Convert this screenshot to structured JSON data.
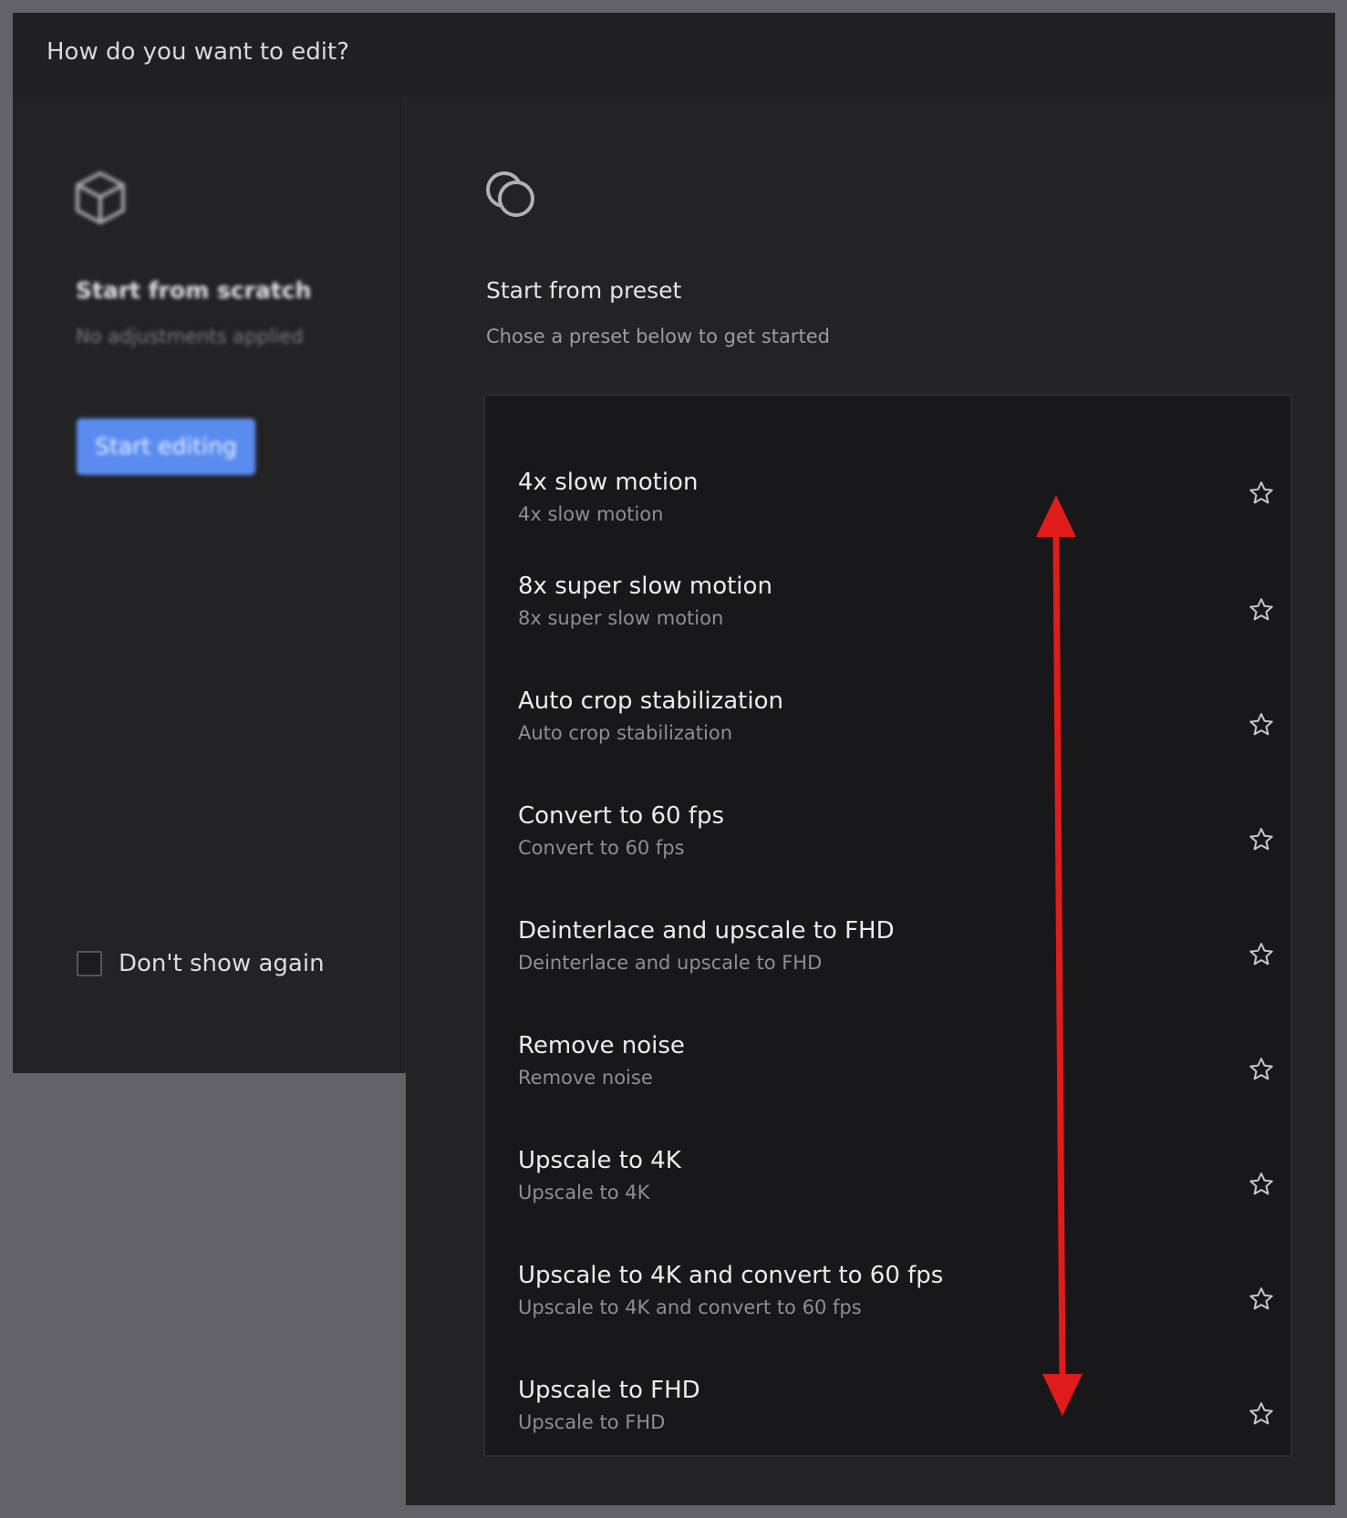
{
  "dialog": {
    "title": "How do you want to edit?"
  },
  "scratch": {
    "icon": "cube-icon",
    "title": "Start from scratch",
    "subtitle": "No adjustments applied",
    "button_label": "Start editing",
    "button_color": "#5a8cf0",
    "checkbox_label": "Don't show again",
    "checkbox_checked": false
  },
  "preset": {
    "icon": "overlapping-circles-icon",
    "title": "Start from preset",
    "subtitle": "Chose a preset below to get started",
    "items": [
      {
        "name": "4x slow motion",
        "description": "4x slow motion",
        "icon": "star-outline-icon"
      },
      {
        "name": "8x super slow motion",
        "description": "8x super slow motion",
        "icon": "star-outline-icon"
      },
      {
        "name": "Auto crop stabilization",
        "description": "Auto crop stabilization",
        "icon": "star-outline-icon"
      },
      {
        "name": "Convert to 60 fps",
        "description": "Convert to 60 fps",
        "icon": "star-outline-icon"
      },
      {
        "name": "Deinterlace and upscale to FHD",
        "description": "Deinterlace and upscale to FHD",
        "icon": "star-outline-icon"
      },
      {
        "name": "Remove noise",
        "description": "Remove noise",
        "icon": "star-outline-icon"
      },
      {
        "name": "Upscale to 4K",
        "description": "Upscale to 4K",
        "icon": "star-outline-icon"
      },
      {
        "name": "Upscale to 4K and convert to 60 fps",
        "description": "Upscale to 4K and convert to 60 fps",
        "icon": "star-outline-icon"
      },
      {
        "name": "Upscale to FHD",
        "description": "Upscale to FHD",
        "icon": "star-outline-icon"
      }
    ]
  },
  "annotation": {
    "type": "double-headed-arrow",
    "color": "#e01b1b"
  }
}
